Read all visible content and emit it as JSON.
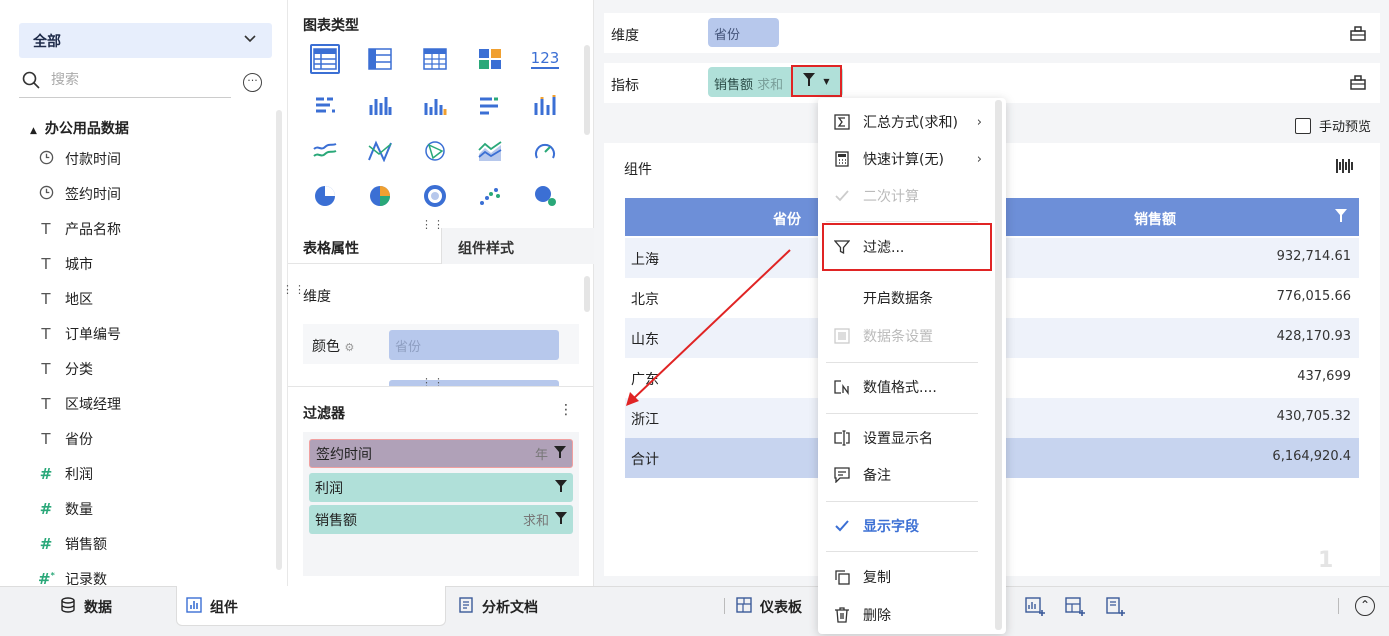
{
  "left": {
    "scope": "全部",
    "search_placeholder": "搜索",
    "root": "办公用品数据",
    "fields": [
      {
        "icon": "clock",
        "label": "付款时间"
      },
      {
        "icon": "clock",
        "label": "签约时间"
      },
      {
        "icon": "text",
        "label": "产品名称"
      },
      {
        "icon": "text",
        "label": "城市"
      },
      {
        "icon": "text",
        "label": "地区"
      },
      {
        "icon": "text",
        "label": "订单编号"
      },
      {
        "icon": "text",
        "label": "分类"
      },
      {
        "icon": "text",
        "label": "区域经理"
      },
      {
        "icon": "text",
        "label": "省份"
      },
      {
        "icon": "num",
        "label": "利润"
      },
      {
        "icon": "num",
        "label": "数量"
      },
      {
        "icon": "num",
        "label": "销售额"
      },
      {
        "icon": "num-star",
        "label": "记录数"
      }
    ]
  },
  "mid": {
    "chart_types_title": "图表类型",
    "tab_table_props": "表格属性",
    "tab_comp_style": "组件样式",
    "dim_label": "维度",
    "color_label": "颜色",
    "color_value": "省份",
    "filter_title": "过滤器",
    "filters": [
      {
        "label": "签约时间",
        "agg": "年"
      },
      {
        "label": "利润",
        "agg": ""
      },
      {
        "label": "销售额",
        "agg": "求和"
      }
    ]
  },
  "right": {
    "dim_label": "维度",
    "dim_value": "省份",
    "metric_label": "指标",
    "metric_value": "销售额",
    "metric_agg": "求和",
    "manual_preview": "手动预览",
    "comp_title": "组件",
    "table": {
      "headers": [
        "省份",
        "销售额"
      ],
      "rows": [
        [
          "上海",
          "932,714.61"
        ],
        [
          "北京",
          "776,015.66"
        ],
        [
          "山东",
          "428,170.93"
        ],
        [
          "广东",
          "437,699"
        ],
        [
          "浙江",
          "430,705.32"
        ]
      ],
      "total": [
        "合计",
        "6,164,920.4"
      ]
    },
    "watermark": "1"
  },
  "menu": {
    "items": [
      {
        "label": "汇总方式(求和)",
        "icon": "sigma"
      },
      {
        "label": "快速计算(无)",
        "icon": "calculator"
      },
      {
        "label": "二次计算",
        "icon": "check"
      },
      {
        "label": "过滤...",
        "icon": "funnel"
      },
      {
        "label": "开启数据条",
        "icon": ""
      },
      {
        "label": "数据条设置",
        "icon": "databar"
      },
      {
        "label": "数值格式....",
        "icon": "format"
      },
      {
        "label": "设置显示名",
        "icon": "rename"
      },
      {
        "label": "备注",
        "icon": "note"
      },
      {
        "label": "显示字段",
        "icon": "check"
      },
      {
        "label": "复制",
        "icon": "copy"
      },
      {
        "label": "删除",
        "icon": "trash"
      }
    ]
  },
  "bottom": {
    "tab_data": "数据",
    "tab_comp": "组件",
    "tab_doc": "分析文档",
    "tab_dash": "仪表板"
  },
  "colors": {
    "accent": "#3b6fd4",
    "table_header": "#6d8fd8",
    "highlight_red": "#e02424",
    "metric_pill": "#b0e0d9",
    "dim_pill": "#b7c8ec"
  }
}
